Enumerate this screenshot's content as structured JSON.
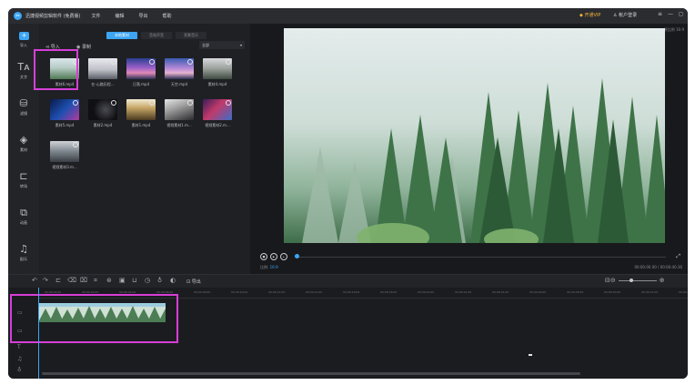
{
  "app": {
    "title": "迅捷视频剪辑软件 (免费版)"
  },
  "menu": [
    "文件",
    "编辑",
    "导出",
    "帮助"
  ],
  "top_right": {
    "vip": "开通VIP",
    "account": "帐户登录"
  },
  "sidebar": [
    {
      "label": "导入",
      "icon": "import-icon"
    },
    {
      "label": "文字",
      "icon": "text-icon"
    },
    {
      "label": "滤镜",
      "icon": "filter-icon"
    },
    {
      "label": "素材",
      "icon": "layers-icon"
    },
    {
      "label": "转场",
      "icon": "transition-icon"
    },
    {
      "label": "动画",
      "icon": "animation-icon"
    },
    {
      "label": "配乐",
      "icon": "music-icon"
    }
  ],
  "library": {
    "tabs": [
      "本地素材",
      "音效声音",
      "背景音乐"
    ],
    "active_tab": 0,
    "import_label": "导入",
    "record_label": "录制",
    "sort_value": "全部",
    "items": [
      {
        "caption": "素材6.mp4"
      },
      {
        "caption": "在-心路历程..."
      },
      {
        "caption": "日落.mp4"
      },
      {
        "caption": "天空.mp4"
      },
      {
        "caption": "素材4.mp4"
      },
      {
        "caption": "素材5.mp4"
      },
      {
        "caption": "素材2.mp4"
      },
      {
        "caption": "素材1.mp4"
      },
      {
        "caption": "视频素材1.m..."
      },
      {
        "caption": "视频素材2.m..."
      },
      {
        "caption": "视频素材3.m..."
      }
    ]
  },
  "preview": {
    "label": "原比例 16:9",
    "aspect_label": "比例:",
    "aspect_value": "16:9",
    "time": "00:00:00.00 / 00:00:40.36",
    "progress": 0
  },
  "toolbar": {
    "export_label": "导出",
    "tools": [
      "undo-icon",
      "redo-icon",
      "split-icon",
      "delete-icon",
      "crop-icon",
      "speed-icon",
      "freeze-icon",
      "mosaic-icon",
      "record-icon",
      "mic-icon",
      "color-icon"
    ]
  },
  "timeline": {
    "ticks": [
      "00:00:00.00",
      "00:00:02.00",
      "00:00:04.00",
      "00:00:06.00",
      "00:00:08.00",
      "00:00:10.00",
      "00:00:12.00",
      "00:00:14.00",
      "00:00:16.00",
      "00:00:18.00",
      "00:00:20.00",
      "00:00:22.00",
      "00:00:24.00",
      "00:00:26.00",
      "00:00:28.00",
      "00:00:30.00",
      "00:00:32.00",
      "00:00:34.00"
    ]
  }
}
